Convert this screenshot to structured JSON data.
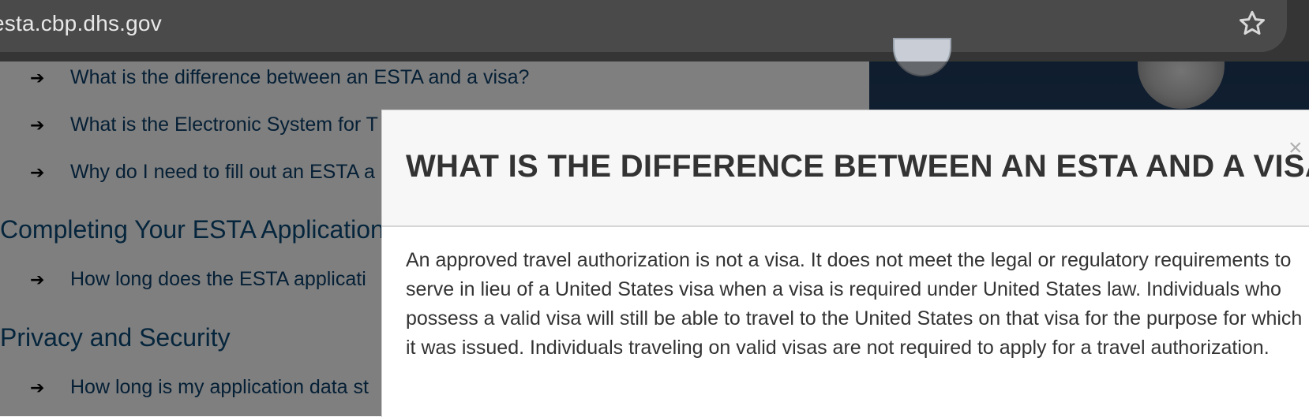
{
  "browser": {
    "url": "esta.cbp.dhs.gov",
    "bookmark_icon": "star-icon"
  },
  "page": {
    "faq_links": [
      {
        "label": "What is the difference between an ESTA and a visa?"
      },
      {
        "label": "What is the Electronic System for T"
      },
      {
        "label": "Why do I need to fill out an ESTA a"
      }
    ],
    "sections": [
      {
        "title": "Completing Your ESTA Application",
        "links": [
          {
            "label": "How long does the ESTA applicati"
          }
        ]
      },
      {
        "title": "Privacy and Security",
        "links": [
          {
            "label": "How long is my application data st"
          }
        ]
      }
    ],
    "arrow_icon": "➔"
  },
  "modal": {
    "title": "WHAT IS THE DIFFERENCE BETWEEN AN ESTA AND A VISA?",
    "close_label": "×",
    "body": "An approved travel authorization is not a visa. It does not meet the legal or regulatory requirements to serve in lieu of a United States visa when a visa is required under United States law. Individuals who possess a valid visa will still be able to travel to the United States on that visa for the purpose for which it was issued. Individuals traveling on valid visas are not required to apply for a travel authorization."
  },
  "colors": {
    "link": "#0a3f6b",
    "heading": "#0a4a79",
    "modal_text": "#333333"
  }
}
